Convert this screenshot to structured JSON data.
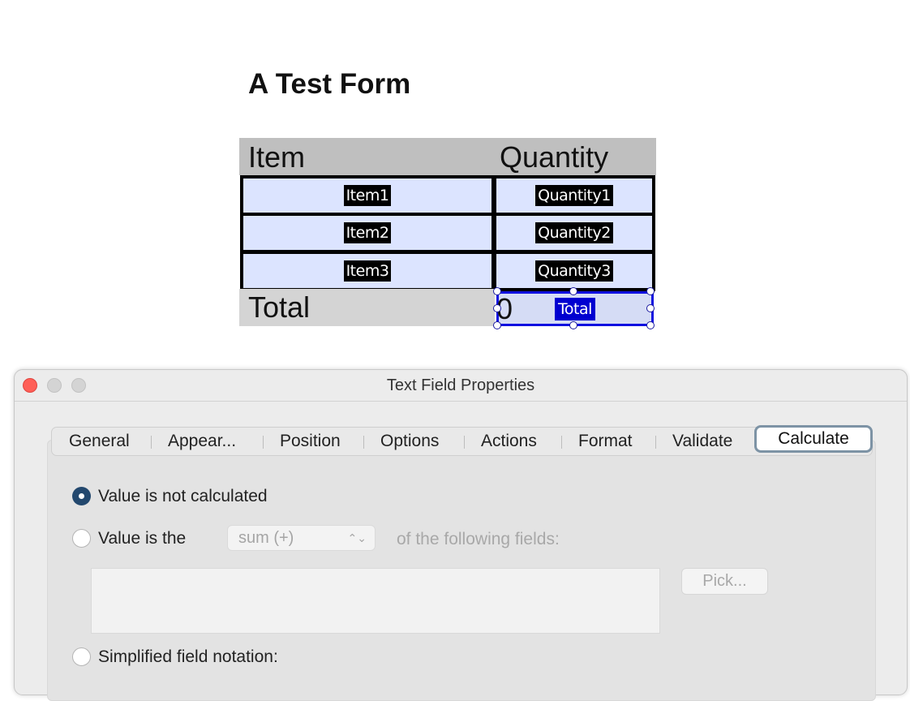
{
  "form": {
    "title": "A Test Form",
    "headers": {
      "item": "Item",
      "quantity": "Quantity"
    },
    "rows": [
      {
        "item_field": "Item1",
        "quantity_field": "Quantity1"
      },
      {
        "item_field": "Item2",
        "quantity_field": "Quantity2"
      },
      {
        "item_field": "Item3",
        "quantity_field": "Quantity3"
      }
    ],
    "total_label": "Total",
    "total_value": "0",
    "total_field": "Total"
  },
  "dialog": {
    "title": "Text Field Properties",
    "tabs": [
      "General",
      "Appear...",
      "Position",
      "Options",
      "Actions",
      "Format",
      "Validate",
      "Calculate"
    ],
    "selected_tab": "Calculate",
    "calculate": {
      "option_not_calculated": "Value is not calculated",
      "option_value_is_the": "Value is the",
      "operation": "sum (+)",
      "of_following_fields": "of the following fields:",
      "pick_button": "Pick...",
      "option_simplified": "Simplified field notation:"
    }
  },
  "colors": {
    "field_fill": "#dce4ff",
    "selected_field_border": "#1010e0",
    "radio_selected": "#23486e",
    "tab_focus_ring": "#7d93a5",
    "close_button": "#ff5f57"
  }
}
